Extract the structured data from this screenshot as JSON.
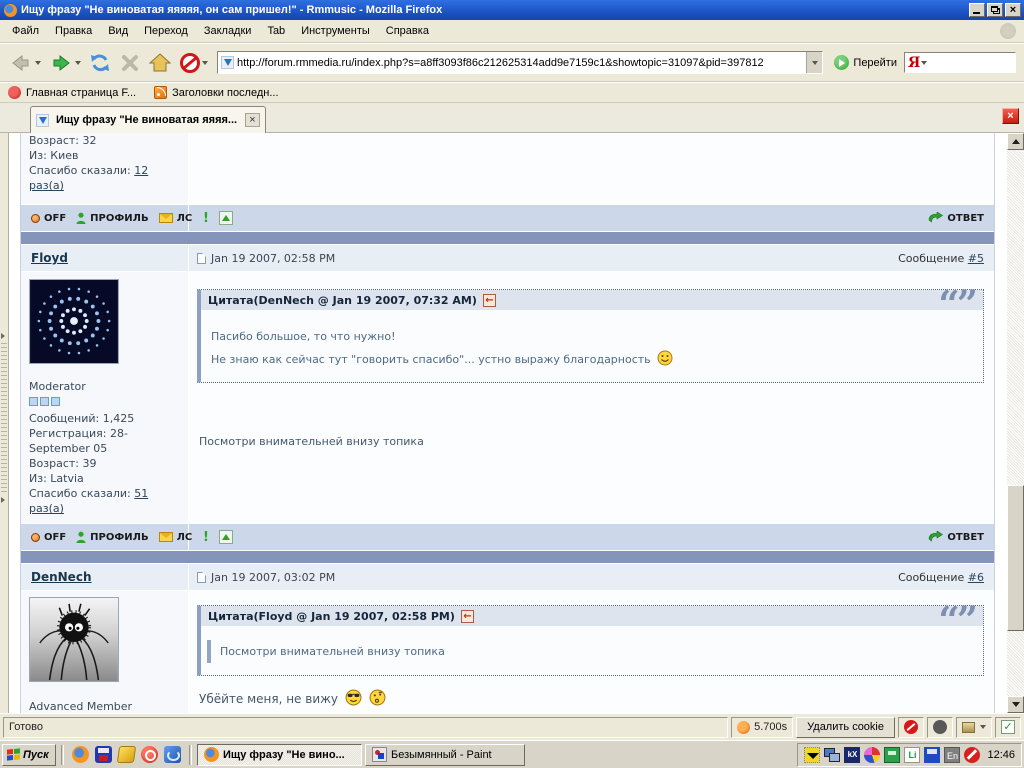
{
  "window": {
    "title": "Ищу фразу \"Не виноватая яяяяя, он сам пришел!\" - Rmmusic - Mozilla Firefox"
  },
  "menubar": {
    "items": [
      "Файл",
      "Правка",
      "Вид",
      "Переход",
      "Закладки",
      "Tab",
      "Инструменты",
      "Справка"
    ]
  },
  "navbar": {
    "url": "http://forum.rmmedia.ru/index.php?s=a8ff3093f86c212625314add9e7159c1&showtopic=31097&pid=397812",
    "go_label": "Перейти",
    "search_letter": "Я"
  },
  "bookmarks": {
    "items": [
      "Главная страница F...",
      "Заголовки последн..."
    ]
  },
  "tabbar": {
    "title": "Ищу фразу \"Не виноватая яяяя..."
  },
  "icons": {
    "report": "!",
    "check": "✓",
    "close": "×",
    "tab_close": "×",
    "back_link": "←",
    "quote_marks": "“”"
  },
  "forum": {
    "msg_label": "Сообщение",
    "controls": {
      "off": "OFF",
      "profile": "ПРОФИЛЬ",
      "pm": "ЛС",
      "reply": "ОТВЕТ"
    },
    "prev_post": {
      "age": "Возраст: 32",
      "location": "Из: Киев",
      "thanks_label": "Спасибо сказали:",
      "thanks_link": "12 раз(а)"
    },
    "post5": {
      "author": "Floyd",
      "date": "Jan 19 2007, 02:58 PM",
      "msg_num": "#5",
      "rank": "Moderator",
      "stat_posts": "Сообщений: 1,425",
      "stat_reg": "Регистрация: 28-September 05",
      "stat_age": "Возраст: 39",
      "stat_from": "Из: Latvia",
      "thanks_label": "Спасибо сказали:",
      "thanks_link": "51 раз(а)",
      "quote_header": "Цитата(DenNech @ Jan 19 2007, 07:32 AM)",
      "quote_line1": "Пасибо большое, то что нужно!",
      "quote_line2": "Не знаю как сейчас тут \"говорить спасибо\"... устно выражу благодарность",
      "body": "Посмотри внимательней внизу топика"
    },
    "post6": {
      "author": "DenNech",
      "date": "Jan 19 2007, 03:02 PM",
      "msg_num": "#6",
      "rank": "Advanced Member",
      "quote_header": "Цитата(Floyd @ Jan 19 2007, 02:58 PM)",
      "quote_body": "Посмотри внимательней внизу топика",
      "body": "Убёйте меня, не вижу"
    }
  },
  "statusbar": {
    "status": "Готово",
    "load_time": "5.700s",
    "delete_cookie_label": "Удалить cookie"
  },
  "taskbar": {
    "start_label": "Пуск",
    "task1": "Ищу фразу \"Не вино...",
    "task2": "Безымянный - Paint",
    "tray_lang": "En",
    "clock": "12:46"
  }
}
